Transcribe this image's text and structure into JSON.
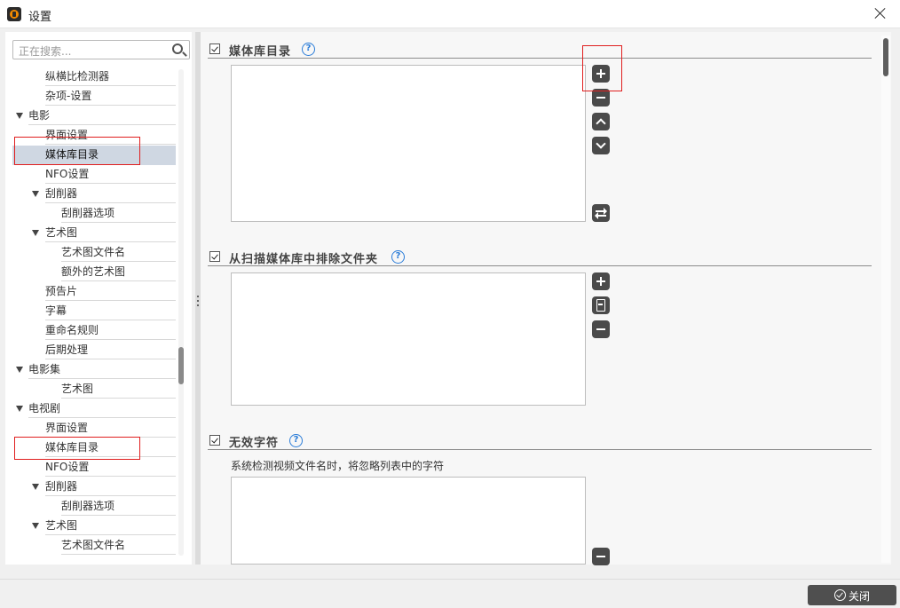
{
  "window": {
    "title": "设置",
    "app_icon": "app-logo-icon",
    "close_icon": "close-icon"
  },
  "search": {
    "placeholder": "正在搜索...",
    "icon": "search-icon"
  },
  "tree": [
    {
      "label": "纵横比检测器"
    },
    {
      "label": "杂项-设置"
    },
    {
      "label": "电影",
      "expanded": true
    },
    {
      "label": "界面设置"
    },
    {
      "label": "媒体库目录",
      "selected": true
    },
    {
      "label": "NFO设置"
    },
    {
      "label": "刮削器",
      "expanded": true
    },
    {
      "label": "刮削器选项"
    },
    {
      "label": "艺术图",
      "expanded": true
    },
    {
      "label": "艺术图文件名"
    },
    {
      "label": "额外的艺术图"
    },
    {
      "label": "预告片"
    },
    {
      "label": "字幕"
    },
    {
      "label": "重命名规则"
    },
    {
      "label": "后期处理"
    },
    {
      "label": "电影集",
      "expanded": true
    },
    {
      "label": "艺术图"
    },
    {
      "label": "电视剧",
      "expanded": true
    },
    {
      "label": "界面设置"
    },
    {
      "label": "媒体库目录"
    },
    {
      "label": "NFO设置"
    },
    {
      "label": "刮削器",
      "expanded": true
    },
    {
      "label": "刮削器选项"
    },
    {
      "label": "艺术图",
      "expanded": true
    },
    {
      "label": "艺术图文件名"
    }
  ],
  "sections": {
    "media_dirs": {
      "title": "媒体库目录",
      "help": "?",
      "buttons": [
        "add",
        "remove",
        "move-up",
        "move-down",
        "exchange"
      ]
    },
    "exclude": {
      "title": "从扫描媒体库中排除文件夹",
      "help": "?",
      "buttons": [
        "add",
        "add-file",
        "remove"
      ]
    },
    "bad_words": {
      "title": "无效字符",
      "help": "?",
      "description": "系统检测视频文件名时，将忽略列表中的字符",
      "buttons": [
        "remove"
      ]
    }
  },
  "footer": {
    "close_label": "关闭"
  },
  "colors": {
    "highlight": "#e01e1e",
    "selection": "#cfd7e2",
    "button": "#4a4a4a",
    "help": "#2a7cd8"
  }
}
